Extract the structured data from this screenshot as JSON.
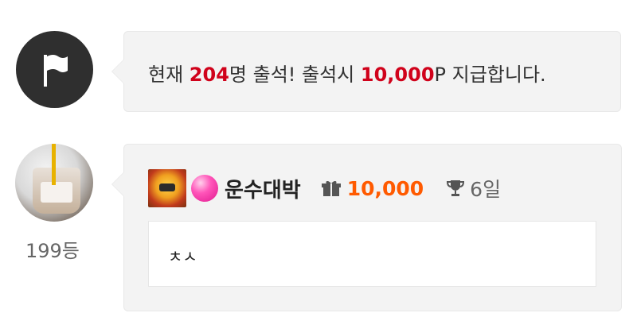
{
  "notice": {
    "icon": "flag-icon",
    "text_prefix": "현재 ",
    "attendees": "204",
    "text_middle": "명 출석! 출석시 ",
    "reward": "10,000",
    "text_suffix": "P 지급합니다.",
    "highlight_color": "#d0021b"
  },
  "entry": {
    "rank": "199등",
    "badge_icon": "level-badge-icon",
    "orb_icon": "pink-orb-icon",
    "username": "운수대박",
    "gift_icon": "gift-icon",
    "points": "10,000",
    "points_color": "#ff5a00",
    "trophy_icon": "trophy-icon",
    "days": "6일",
    "comment": "ㅊㅅ"
  }
}
